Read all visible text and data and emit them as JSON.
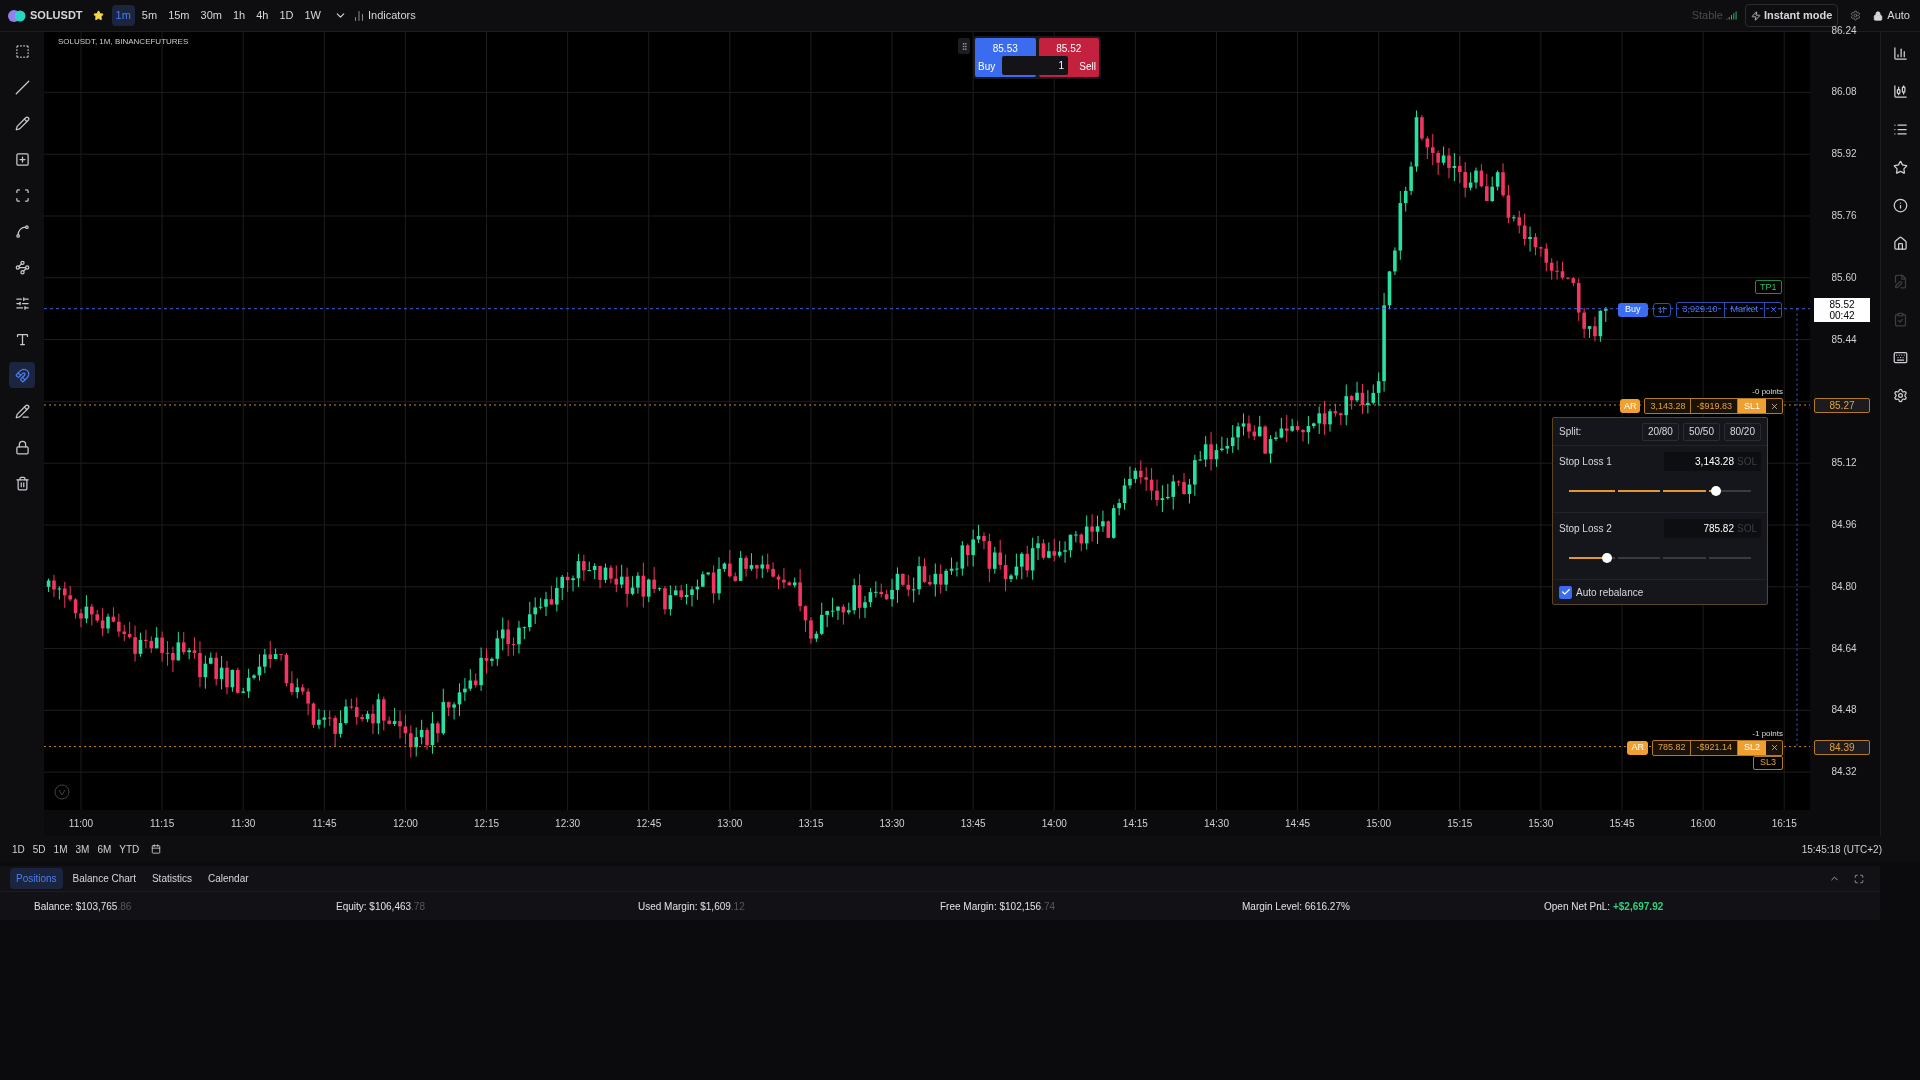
{
  "top_bar": {
    "symbol": "SOLUSDT",
    "favorite": true,
    "timeframes": [
      {
        "label": "1m",
        "selected": true
      },
      {
        "label": "5m",
        "selected": false
      },
      {
        "label": "15m",
        "selected": false
      },
      {
        "label": "30m",
        "selected": false
      },
      {
        "label": "1h",
        "selected": false
      },
      {
        "label": "4h",
        "selected": false
      },
      {
        "label": "1D",
        "selected": false
      },
      {
        "label": "1W",
        "selected": false
      }
    ],
    "indicators": "Indicators",
    "connection": "Stable",
    "instant_mode": "Instant mode",
    "auto": "Auto"
  },
  "left_toolbar": [
    {
      "selected": false
    },
    {
      "selected": false
    },
    {
      "selected": false
    },
    {
      "selected": false
    },
    {
      "selected": false
    },
    {
      "selected": false
    },
    {
      "selected": false
    },
    {
      "selected": false
    },
    {
      "selected": false
    },
    {
      "selected": true
    },
    {
      "selected": false
    },
    {
      "selected": false
    },
    {
      "selected": false
    }
  ],
  "right_sidebar": [
    {
      "disabled": false
    },
    {
      "disabled": false
    },
    {
      "disabled": false
    },
    {
      "disabled": false
    },
    {
      "disabled": false
    },
    {
      "disabled": false
    },
    {
      "disabled": true
    },
    {
      "disabled": true
    },
    {
      "disabled": false
    },
    {
      "disabled": false
    }
  ],
  "chart": {
    "legend": "SOLUSDT, 1M, BINANCEFUTURES",
    "price_axis": [
      "86.24",
      "86.08",
      "85.92",
      "85.76",
      "85.60",
      "85.44",
      "85.12",
      "84.96",
      "84.80",
      "84.64",
      "84.48",
      "84.32"
    ],
    "time_axis": [
      "11:00",
      "11:15",
      "11:30",
      "11:45",
      "12:00",
      "12:15",
      "12:30",
      "12:45",
      "13:00",
      "13:15",
      "13:30",
      "13:45",
      "14:00",
      "14:15",
      "14:30",
      "14:45",
      "15:00",
      "15:15",
      "15:30",
      "15:45",
      "16:00",
      "16:15"
    ],
    "current_price": {
      "price": "85.52",
      "countdown": "00:42"
    }
  },
  "quick_trade": {
    "buy_price": "85.53",
    "buy": "Buy",
    "sell_price": "85.52",
    "sell": "Sell",
    "quantity": "1"
  },
  "orders": [
    {
      "kind": "entry",
      "side": "Buy",
      "size": "3,929.10",
      "type": "Market",
      "target": "TP1"
    },
    {
      "kind": "stop",
      "tag": "AR",
      "size": "3,143.28",
      "pnl": "-$919.83",
      "label": "SL1",
      "points": "-0 points",
      "axis_price": "85.27"
    },
    {
      "kind": "stop",
      "tag": "AR",
      "size": "785.82",
      "pnl": "-$921.14",
      "label": "SL2",
      "points": "-1 points",
      "axis_price": "84.39",
      "extra": "SL3"
    }
  ],
  "split_panel": {
    "title": "Split:",
    "presets": [
      "20/80",
      "50/50",
      "80/20"
    ],
    "legs": [
      {
        "label": "Stop Loss 1",
        "value": "3,143.28",
        "unit": "SOL",
        "level": 0.81
      },
      {
        "label": "Stop Loss 2",
        "value": "785.82",
        "unit": "SOL",
        "level": 0.21
      }
    ],
    "auto_rebalance": {
      "label": "Auto rebalance",
      "checked": true
    }
  },
  "range_bar": {
    "ranges": [
      "1D",
      "5D",
      "1M",
      "3M",
      "6M",
      "YTD"
    ],
    "clock": "15:45:18 (UTC+2)"
  },
  "bottom_tabs": [
    {
      "label": "Positions",
      "selected": true
    },
    {
      "label": "Balance Chart",
      "selected": false
    },
    {
      "label": "Statistics",
      "selected": false
    },
    {
      "label": "Calendar",
      "selected": false
    }
  ],
  "account": [
    {
      "kind": "money",
      "label": "Balance:",
      "value": "$103,765",
      "decimals": ".86"
    },
    {
      "kind": "money",
      "label": "Equity:",
      "value": "$106,463",
      "decimals": ".78"
    },
    {
      "kind": "money",
      "label": "Used Margin:",
      "value": "$1,609",
      "decimals": ".12"
    },
    {
      "kind": "money",
      "label": "Free Margin:",
      "value": "$102,156",
      "decimals": ".74"
    },
    {
      "kind": "plain",
      "label": "Margin Level:",
      "value": "6616.27%"
    },
    {
      "kind": "pnl",
      "label": "Open Net PnL:",
      "value": "+$2,697.92"
    }
  ]
}
